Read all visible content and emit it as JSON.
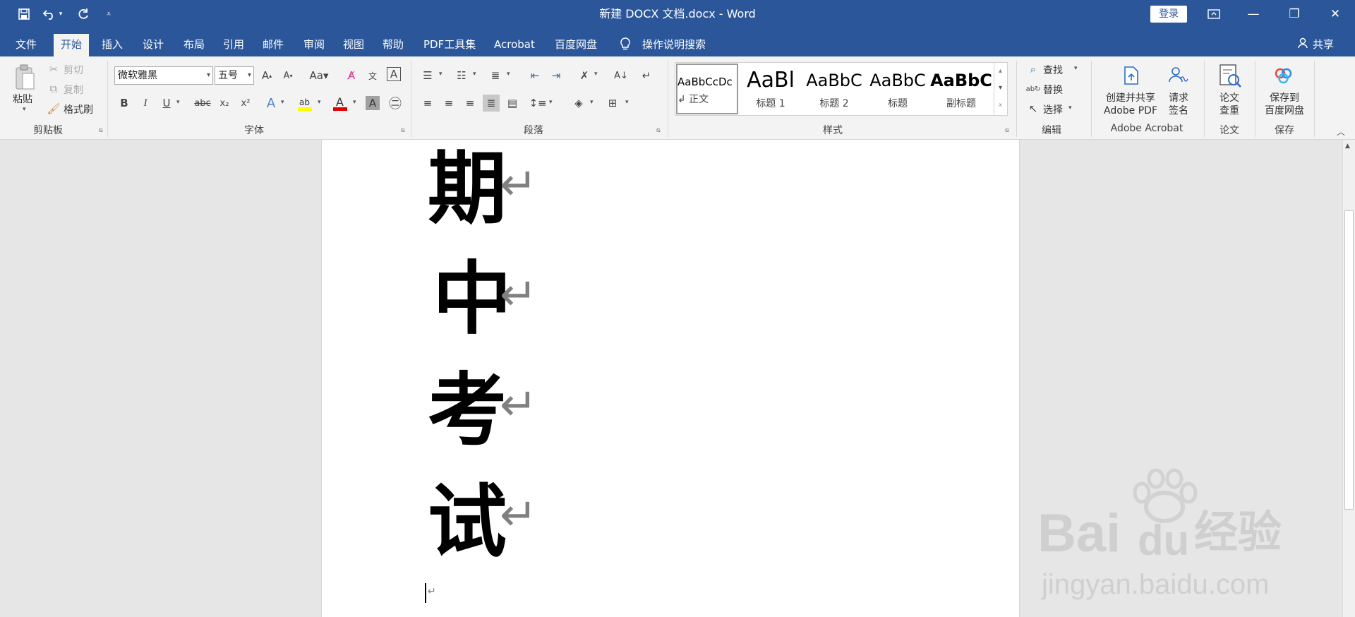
{
  "titlebar": {
    "title": "新建 DOCX 文档.docx  -  Word",
    "login": "登录"
  },
  "menu": {
    "tabs": [
      "文件",
      "开始",
      "插入",
      "设计",
      "布局",
      "引用",
      "邮件",
      "审阅",
      "视图",
      "帮助",
      "PDF工具集",
      "Acrobat",
      "百度网盘"
    ],
    "search": "操作说明搜索",
    "share": "共享"
  },
  "ribbon": {
    "clipboard": {
      "paste": "粘贴",
      "cut": "剪切",
      "copy": "复制",
      "format_painter": "格式刷",
      "label": "剪贴板"
    },
    "font": {
      "name": "微软雅黑",
      "size": "五号",
      "label": "字体",
      "bold": "B",
      "italic": "I",
      "underline": "U",
      "strike": "abc",
      "subscript": "x₂",
      "superscript": "x²"
    },
    "paragraph": {
      "label": "段落"
    },
    "styles": {
      "label": "样式",
      "items": [
        {
          "preview": "AaBbCcDc",
          "name": "↲ 正文"
        },
        {
          "preview": "AaBl",
          "name": "标题 1"
        },
        {
          "preview": "AaBbC",
          "name": "标题 2"
        },
        {
          "preview": "AaBbC",
          "name": "标题"
        },
        {
          "preview": "AaBbC",
          "name": "副标题"
        }
      ]
    },
    "editing": {
      "find": "查找",
      "replace": "替换",
      "select": "选择",
      "label": "编辑"
    },
    "acrobat": {
      "create_line1": "创建并共享",
      "create_line2": "Adobe PDF",
      "sign_line1": "请求",
      "sign_line2": "签名",
      "label": "Adobe Acrobat"
    },
    "paper": {
      "check_line1": "论文",
      "check_line2": "查重",
      "label": "论文"
    },
    "save": {
      "save_line1": "保存到",
      "save_line2": "百度网盘",
      "label": "保存"
    }
  },
  "document": {
    "lines": [
      "期",
      "中",
      "考",
      "试"
    ],
    "paragraph_mark": "↵"
  },
  "watermark": {
    "brand_a": "Bai",
    "brand_b": "du",
    "brand_c": "经验",
    "url": "jingyan.baidu.com"
  }
}
